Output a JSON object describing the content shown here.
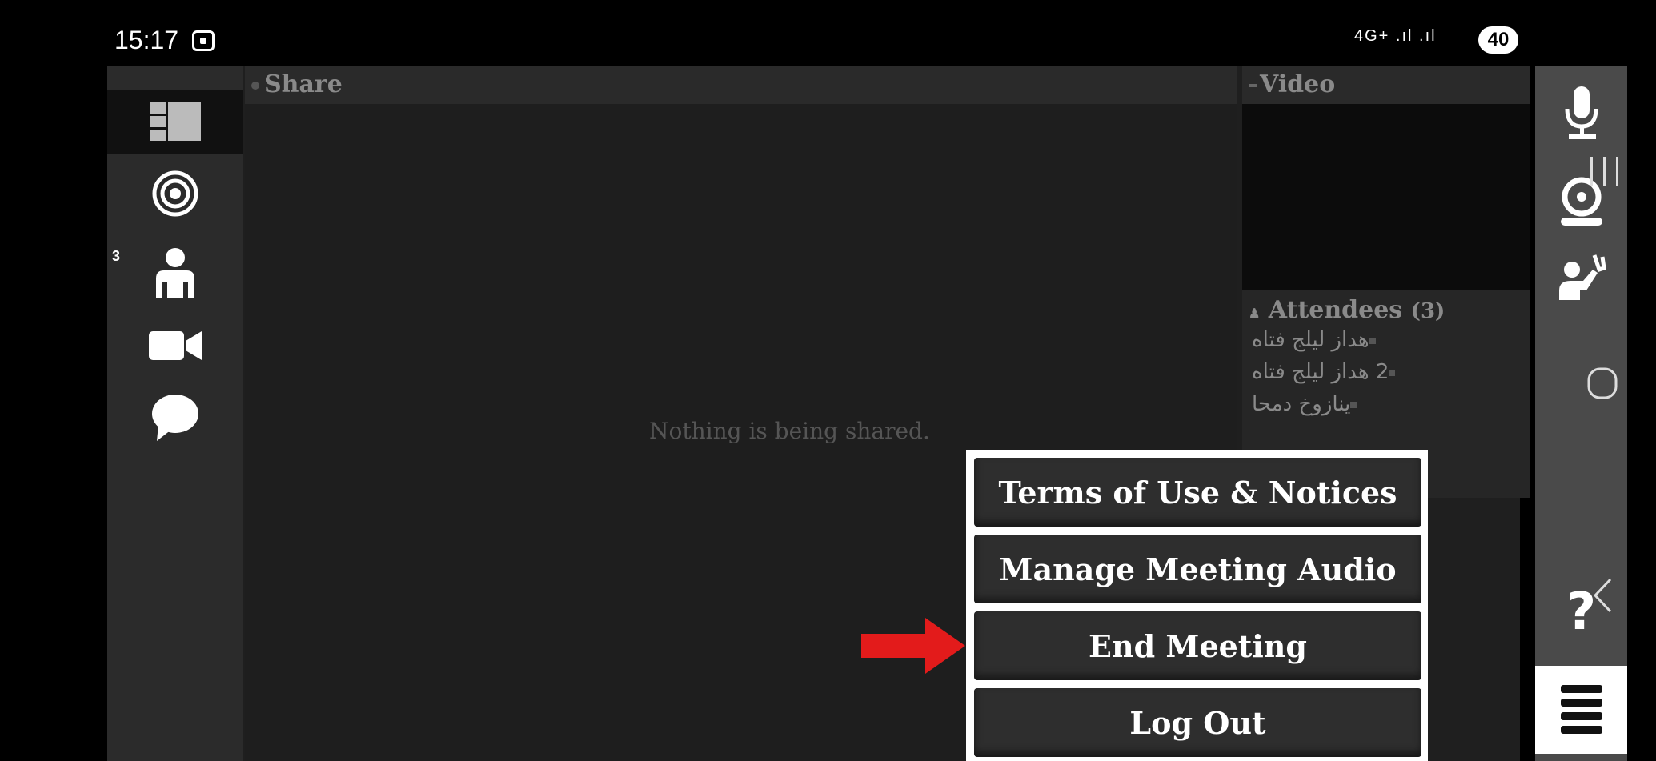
{
  "status_bar": {
    "time": "15:17",
    "network": "4G+ .ıl .ıl",
    "battery": "40"
  },
  "share": {
    "title": "Share",
    "empty_message": "Nothing is being shared."
  },
  "video": {
    "title": "Video"
  },
  "attendees": {
    "title": "Attendees",
    "count": "(3)",
    "list": [
      "هداز لیلج فتاه",
      "2 هداز لیلج فتاه",
      "ینازوخ دمحا"
    ]
  },
  "left_sidebar": {
    "participants_badge": "3",
    "items": [
      {
        "name": "layout-icon"
      },
      {
        "name": "target-icon"
      },
      {
        "name": "participants-icon"
      },
      {
        "name": "camera-icon"
      },
      {
        "name": "chat-icon"
      }
    ]
  },
  "right_sidebar": {
    "items": [
      {
        "name": "microphone-icon"
      },
      {
        "name": "webcam-icon"
      },
      {
        "name": "raise-hand-icon"
      },
      {
        "name": "help-icon"
      },
      {
        "name": "hamburger-menu-icon"
      }
    ],
    "help_label": "?"
  },
  "menu": {
    "items": [
      "Terms of Use & Notices",
      "Manage Meeting Audio",
      "End Meeting",
      "Log Out"
    ],
    "highlighted_item": "End Meeting",
    "arrow_color": "#e31b1b"
  },
  "android_nav": [
    {
      "name": "recent-apps-icon"
    },
    {
      "name": "home-icon"
    },
    {
      "name": "back-icon"
    }
  ]
}
